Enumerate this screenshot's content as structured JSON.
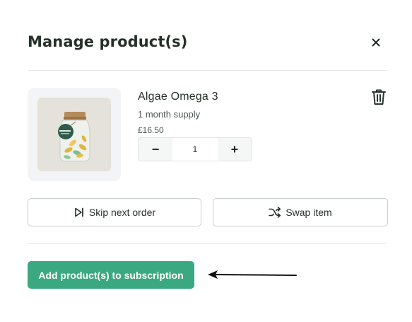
{
  "modal": {
    "title": "Manage product(s)",
    "close_icon": "close-icon"
  },
  "product": {
    "name": "Algae Omega 3",
    "supply": "1 month supply",
    "price": "£16.50",
    "image_alt": "Algae Omega 3 jar",
    "jar_label": "Omega 3"
  },
  "quantity": {
    "value": "1",
    "decrease_symbol": "−",
    "increase_symbol": "+"
  },
  "actions": {
    "skip_label": "Skip next order",
    "swap_label": "Swap item",
    "add_label": "Add product(s) to subscription"
  },
  "icons": {
    "close": "close-icon",
    "trash": "trash-icon",
    "skip": "skip-next-icon",
    "swap": "shuffle-icon",
    "annotation": "arrow-left-icon"
  },
  "colors": {
    "primary": "#3aa981",
    "text": "#243028",
    "border": "#c9cfcc"
  }
}
